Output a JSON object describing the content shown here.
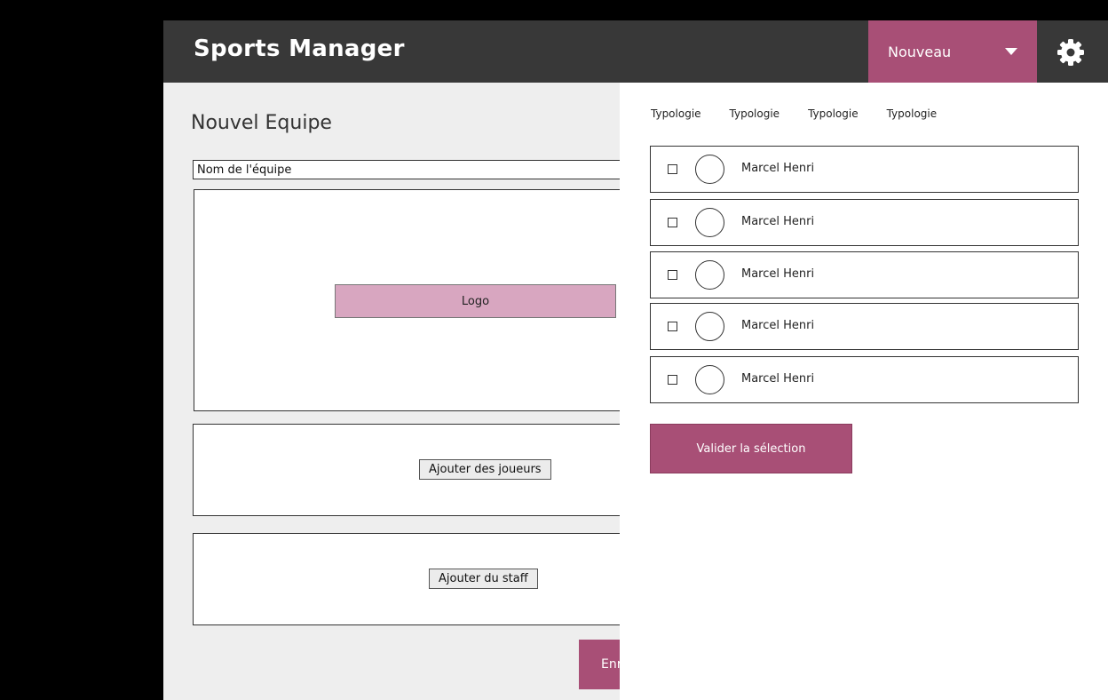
{
  "header": {
    "title": "Sports Manager",
    "new_dropdown_label": "Nouveau",
    "settings_icon": "gear-icon",
    "accent_color": "#a84f76"
  },
  "form": {
    "title": "Nouvel Equipe",
    "team_name_value": "Nom de l'équipe",
    "logo_label": "Logo",
    "add_players_label": "Ajouter des joueurs",
    "add_staff_label": "Ajouter du staff",
    "save_label": "Enr"
  },
  "panel": {
    "tabs": [
      "Typologie",
      "Typologie",
      "Typologie",
      "Typologie"
    ],
    "players": [
      {
        "name": "Marcel Henri",
        "checked": false
      },
      {
        "name": "Marcel Henri",
        "checked": false
      },
      {
        "name": "Marcel Henri",
        "checked": false
      },
      {
        "name": "Marcel Henri",
        "checked": false
      },
      {
        "name": "Marcel Henri",
        "checked": false
      }
    ],
    "validate_label": "Valider la sélection"
  }
}
